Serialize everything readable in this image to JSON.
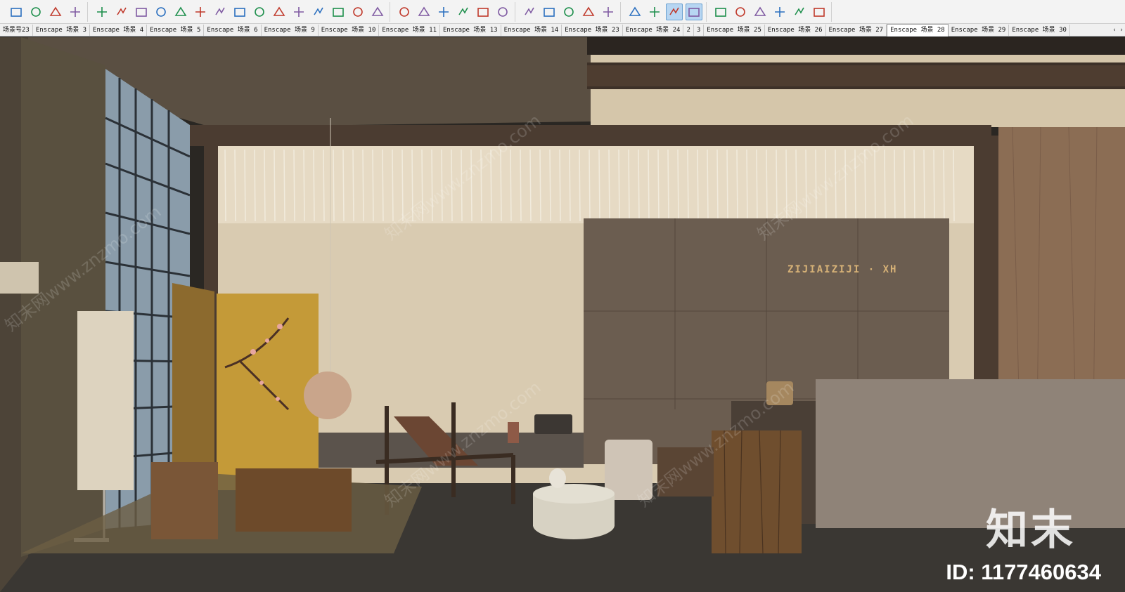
{
  "toolbar": {
    "groups": [
      [
        "open-folder-icon",
        "model-info-icon",
        "import-icon",
        "export-icon"
      ],
      [
        "select-icon",
        "component-icon",
        "line-icon",
        "rectangle-icon",
        "push-pull-icon",
        "offset-icon",
        "arc-icon",
        "freehand-icon",
        "eraser-icon",
        "grid-icon",
        "knife-icon",
        "follow-me-icon",
        "basket-icon",
        "layers-icon",
        "box-icon"
      ],
      [
        "move-up-icon",
        "plane-icon",
        "download-icon",
        "cube-icon",
        "marquee-icon",
        "face-icon"
      ],
      [
        "curve-icon",
        "section-icon",
        "paint-bucket-icon",
        "tape-measure-icon",
        "zoom-extents-icon"
      ],
      [
        "pan-icon",
        "iso-view-icon",
        "top-view-icon",
        "front-view-icon"
      ],
      [
        "house-iso-icon",
        "house-side-icon",
        "house-front-icon",
        "house-back-icon",
        "house-outline-icon",
        "house-garage-icon"
      ]
    ],
    "active": [
      "top-view-icon",
      "front-view-icon"
    ]
  },
  "scenes": {
    "tabs": [
      "场景号23",
      "Enscape 场景 3",
      "Enscape 场景 4",
      "Enscape 场景 5",
      "Enscape 场景 6",
      "Enscape 场景 9",
      "Enscape 场景 10",
      "Enscape 场景 11",
      "Enscape 场景 13",
      "Enscape 场景 14",
      "Enscape 场景 23",
      "Enscape 场景 24",
      "2",
      "3",
      "Enscape 场景 25",
      "Enscape 场景 26",
      "Enscape 场景 27",
      "Enscape 场景 28",
      "Enscape 场景 29",
      "Enscape 场景 30"
    ],
    "active_index": 17,
    "nav_left": "‹",
    "nav_right": "›"
  },
  "viewport": {
    "sign_text": "ZIJIAIZIJI · XH",
    "watermark_text": "知末网www.znzmo.com",
    "watermark_logo": "知末",
    "watermark_id": "ID: 1177460634"
  },
  "colors": {
    "wall_beige": "#d9cbb1",
    "ceiling_dark": "#5a4f42",
    "wood_panel": "#6b5d50",
    "glass": "#8a9caa",
    "floor": "#3a3733"
  }
}
